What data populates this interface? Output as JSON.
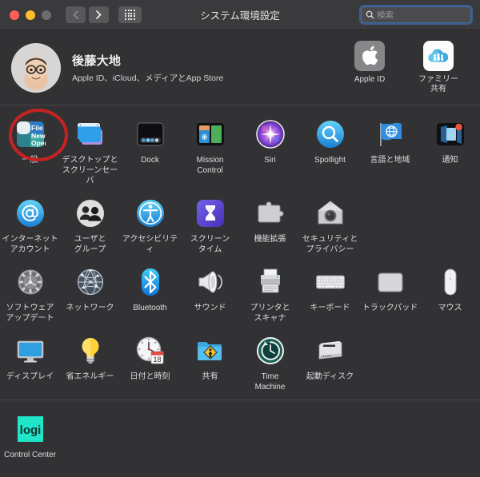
{
  "window": {
    "title": "システム環境設定",
    "traffic_lights": [
      "close",
      "minimize",
      "zoom"
    ],
    "back_label": "‹",
    "forward_label": "›",
    "show_all_label": "show-all-grid"
  },
  "search": {
    "placeholder": "検索",
    "value": ""
  },
  "user": {
    "name": "後藤大地",
    "subtitle": "Apple ID、iCloud、メディアとApp Store",
    "actions": [
      {
        "label": "Apple ID",
        "icon": "apple-logo-icon"
      },
      {
        "label": "ファミリー\n共有",
        "label_line1": "ファミリー",
        "label_line2": "共有",
        "icon": "family-cloud-icon"
      }
    ]
  },
  "annotation": {
    "target": "一般",
    "color": "#c62222",
    "shape": "circle"
  },
  "prefs": [
    {
      "id": "general",
      "label": "一般",
      "icon": "general-icon",
      "highlighted": true
    },
    {
      "id": "desktop",
      "label": "デスクトップと\nスクリーンセーバ",
      "l1": "デスクトップと",
      "l2": "スクリーンセーバ",
      "icon": "desktop-screensaver-icon"
    },
    {
      "id": "dock",
      "label": "Dock",
      "icon": "dock-icon"
    },
    {
      "id": "mission",
      "label": "Mission\nControl",
      "l1": "Mission",
      "l2": "Control",
      "icon": "mission-control-icon"
    },
    {
      "id": "siri",
      "label": "Siri",
      "icon": "siri-icon"
    },
    {
      "id": "spotlight",
      "label": "Spotlight",
      "icon": "spotlight-icon"
    },
    {
      "id": "language",
      "label": "言語と地域",
      "icon": "language-region-icon"
    },
    {
      "id": "notifications",
      "label": "通知",
      "icon": "notifications-icon"
    },
    {
      "id": "internet",
      "label": "インターネット\nアカウント",
      "l1": "インターネット",
      "l2": "アカウント",
      "icon": "internet-accounts-icon"
    },
    {
      "id": "users",
      "label": "ユーザと\nグループ",
      "l1": "ユーザと",
      "l2": "グループ",
      "icon": "users-groups-icon"
    },
    {
      "id": "accessibility",
      "label": "アクセシビリティ",
      "icon": "accessibility-icon"
    },
    {
      "id": "screentime",
      "label": "スクリーン\nタイム",
      "l1": "スクリーン",
      "l2": "タイム",
      "icon": "screen-time-icon"
    },
    {
      "id": "extensions",
      "label": "機能拡張",
      "icon": "extensions-icon"
    },
    {
      "id": "security",
      "label": "セキュリティと\nプライバシー",
      "l1": "セキュリティと",
      "l2": "プライバシー",
      "icon": "security-privacy-icon"
    },
    {
      "id": "softwareupdate",
      "label": "ソフトウェア\nアップデート",
      "l1": "ソフトウェア",
      "l2": "アップデート",
      "icon": "software-update-icon"
    },
    {
      "id": "network",
      "label": "ネットワーク",
      "icon": "network-icon"
    },
    {
      "id": "bluetooth",
      "label": "Bluetooth",
      "icon": "bluetooth-icon"
    },
    {
      "id": "sound",
      "label": "サウンド",
      "icon": "sound-icon"
    },
    {
      "id": "printers",
      "label": "プリンタと\nスキャナ",
      "l1": "プリンタと",
      "l2": "スキャナ",
      "icon": "printers-scanners-icon"
    },
    {
      "id": "keyboard",
      "label": "キーボード",
      "icon": "keyboard-icon"
    },
    {
      "id": "trackpad",
      "label": "トラックパッド",
      "icon": "trackpad-icon"
    },
    {
      "id": "mouse",
      "label": "マウス",
      "icon": "mouse-icon"
    },
    {
      "id": "displays",
      "label": "ディスプレイ",
      "icon": "displays-icon"
    },
    {
      "id": "energy",
      "label": "省エネルギー",
      "icon": "energy-saver-icon"
    },
    {
      "id": "datetime",
      "label": "日付と時刻",
      "icon": "date-time-icon",
      "badge_day": "18"
    },
    {
      "id": "sharing",
      "label": "共有",
      "icon": "sharing-icon"
    },
    {
      "id": "timemachine",
      "label": "Time\nMachine",
      "l1": "Time",
      "l2": "Machine",
      "icon": "time-machine-icon"
    },
    {
      "id": "startupdisk",
      "label": "起動ディスク",
      "icon": "startup-disk-icon"
    }
  ],
  "third_party": [
    {
      "id": "logi-control-center",
      "label": "Control Center",
      "icon": "logi-icon",
      "logo_text": "logi",
      "color": "#1fe6c8"
    }
  ]
}
